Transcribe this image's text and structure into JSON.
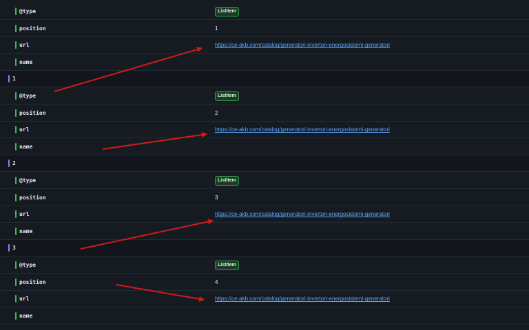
{
  "colors": {
    "background": "#161b22",
    "key_bar_child": "#3fb950",
    "key_bar_group": "#a371f7",
    "link": "#58a6ff",
    "arrow": "#d41a1a"
  },
  "rows": [
    {
      "kind": "child",
      "key": "@type",
      "value_type": "badge",
      "value": "ListItem"
    },
    {
      "kind": "child",
      "key": "position",
      "value_type": "text",
      "value": "1"
    },
    {
      "kind": "child",
      "key": "url",
      "value_type": "link",
      "value": "https://ce-akb.com/catalog/generatori-invertori-energosistemi-generatori"
    },
    {
      "kind": "child",
      "key": "name",
      "value_type": "empty",
      "value": ""
    },
    {
      "kind": "group",
      "key": "1"
    },
    {
      "kind": "child",
      "key": "@type",
      "value_type": "badge",
      "value": "ListItem"
    },
    {
      "kind": "child",
      "key": "position",
      "value_type": "text",
      "value": "2"
    },
    {
      "kind": "child",
      "key": "url",
      "value_type": "link",
      "value": "https://ce-akb.com/catalog/generatori-invertori-energosistemi-generatori"
    },
    {
      "kind": "child",
      "key": "name",
      "value_type": "empty",
      "value": ""
    },
    {
      "kind": "group",
      "key": "2"
    },
    {
      "kind": "child",
      "key": "@type",
      "value_type": "badge",
      "value": "ListItem"
    },
    {
      "kind": "child",
      "key": "position",
      "value_type": "text",
      "value": "3"
    },
    {
      "kind": "child",
      "key": "url",
      "value_type": "link",
      "value": "https://ce-akb.com/catalog/generatori-invertori-energosistemi-generatori"
    },
    {
      "kind": "child",
      "key": "name",
      "value_type": "empty",
      "value": ""
    },
    {
      "kind": "group",
      "key": "3"
    },
    {
      "kind": "child",
      "key": "@type",
      "value_type": "badge",
      "value": "ListItem"
    },
    {
      "kind": "child",
      "key": "position",
      "value_type": "text",
      "value": "4"
    },
    {
      "kind": "child",
      "key": "url",
      "value_type": "link",
      "value": "https://ce-akb.com/catalog/generatori-invertori-energosistemi-generatori"
    },
    {
      "kind": "child",
      "key": "name",
      "value_type": "empty",
      "value": ""
    }
  ],
  "annotations": {
    "arrow_count": 4
  }
}
